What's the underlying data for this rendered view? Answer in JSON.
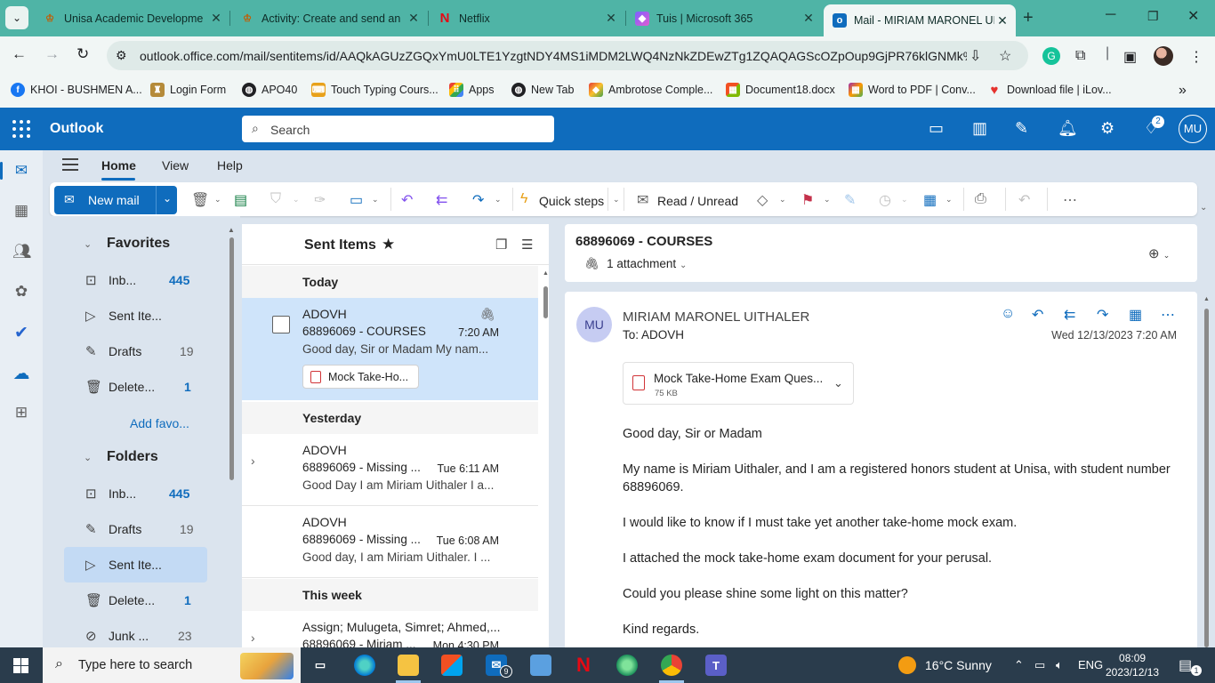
{
  "browser": {
    "tabs": [
      {
        "title": "Unisa Academic Developme",
        "favicon": "unisa-icon"
      },
      {
        "title": "Activity: Create and send an",
        "favicon": "unisa-icon"
      },
      {
        "title": "Netflix",
        "favicon": "netflix-icon"
      },
      {
        "title": "Tuis | Microsoft 365",
        "favicon": "m365-icon"
      },
      {
        "title": "Mail - MIRIAM MARONEL UI",
        "favicon": "outlook-icon",
        "active": true
      }
    ],
    "url": "outlook.office.com/mail/sentitems/id/AAQkAGUzZGQxYmU0LTE1YzgtNDY4MS1iMDM2LWQ4NzNkZDEwZTg1ZQAQAGScOZpOup9GjPR76klGNMk%3D",
    "bookmarks": [
      {
        "label": "KHOI - BUSHMEN A...",
        "icon": "facebook-icon",
        "color": "#1877f2"
      },
      {
        "label": "Login Form",
        "icon": "trophy-icon",
        "color": "#b58b3a"
      },
      {
        "label": "APO40",
        "icon": "globe-icon",
        "color": "#202124"
      },
      {
        "label": "Touch Typing Cours...",
        "icon": "typing-icon",
        "color": "#e8a11a"
      },
      {
        "label": "Apps",
        "icon": "apps-grid-icon",
        "color": "#4285f4"
      },
      {
        "label": "New Tab",
        "icon": "globe-icon",
        "color": "#202124"
      },
      {
        "label": "Ambrotose Comple...",
        "icon": "ambrotose-icon",
        "color": "#e53935"
      },
      {
        "label": "Document18.docx",
        "icon": "office-icon",
        "color": "#eb3c00"
      },
      {
        "label": "Word to PDF | Conv...",
        "icon": "pdf-tool-icon",
        "color": "#9c27b0"
      },
      {
        "label": "Download file | iLov...",
        "icon": "heart-icon",
        "color": "#e5322d"
      }
    ]
  },
  "outlook": {
    "app_name": "Outlook",
    "search_placeholder": "Search",
    "notification_badge": "2",
    "user_initials": "MU",
    "ribbon_tabs": [
      "Home",
      "View",
      "Help"
    ],
    "ribbon": {
      "new_mail": "New mail",
      "quick_steps": "Quick steps",
      "read_unread": "Read / Unread"
    },
    "folders": {
      "favorites_header": "Favorites",
      "favorites": [
        {
          "label": "Inb...",
          "count": "445",
          "icon": "inbox-icon",
          "count_style": "blue"
        },
        {
          "label": "Sent Ite...",
          "count": "",
          "icon": "send-icon"
        },
        {
          "label": "Drafts",
          "count": "19",
          "icon": "pencil-icon",
          "count_style": "grey"
        },
        {
          "label": "Delete...",
          "count": "1",
          "icon": "trash-icon",
          "count_style": "blue"
        }
      ],
      "add_favorite": "Add favo...",
      "folders_header": "Folders",
      "folders": [
        {
          "label": "Inb...",
          "count": "445",
          "icon": "inbox-icon",
          "count_style": "blue"
        },
        {
          "label": "Drafts",
          "count": "19",
          "icon": "pencil-icon",
          "count_style": "grey"
        },
        {
          "label": "Sent Ite...",
          "count": "",
          "icon": "send-icon",
          "active": true
        },
        {
          "label": "Delete...",
          "count": "1",
          "icon": "trash-icon",
          "count_style": "blue"
        },
        {
          "label": "Junk ...",
          "count": "23",
          "icon": "junk-icon",
          "count_style": "grey"
        }
      ]
    },
    "message_list": {
      "title": "Sent Items",
      "groups": {
        "today": "Today",
        "yesterday": "Yesterday",
        "this_week": "This week"
      },
      "messages": [
        {
          "sender": "ADOVH",
          "subject": "68896069 - COURSES",
          "time": "7:20 AM",
          "preview": "Good day, Sir or Madam My nam...",
          "attachment": "Mock Take-Ho..."
        },
        {
          "sender": "ADOVH",
          "subject": "68896069 - Missing ...",
          "time": "Tue 6:11 AM",
          "preview": "Good Day I am Miriam Uithaler I a..."
        },
        {
          "sender": "ADOVH",
          "subject": "68896069 - Missing ...",
          "time": "Tue 6:08 AM",
          "preview": "Good day, I am Miriam Uithaler. I ..."
        },
        {
          "sender": "Assign; Mulugeta, Simret; Ahmed,...",
          "subject": "68896069 - Miriam ...",
          "time": "Mon 4:30 PM",
          "preview": ""
        }
      ]
    },
    "reading": {
      "subject": "68896069 - COURSES",
      "attachment_summary": "1 attachment",
      "from_initials": "MU",
      "from": "MIRIAM MARONEL UITHALER",
      "to": "To:  ADOVH",
      "date": "Wed 12/13/2023 7:20 AM",
      "attachment_name": "Mock Take-Home Exam Ques...",
      "attachment_size": "75 KB",
      "body": [
        "Good day, Sir or Madam",
        "My name is Miriam Uithaler, and I am a registered honors student at Unisa, with student number 68896069.",
        "I would like to know if I must take yet another take-home mock exam.",
        "I attached the mock take-home exam document for your perusal.",
        "Could you please shine some light on this matter?",
        "Kind regards."
      ]
    }
  },
  "taskbar": {
    "search_placeholder": "Type here to search",
    "weather": "16°C  Sunny",
    "language": "ENG",
    "time": "08:09",
    "date": "2023/12/13",
    "mail_badge": "9",
    "notification_count": "1"
  },
  "colors": {
    "outlook_blue": "#0f6cbd",
    "tab_strip": "#4fb4a6",
    "selected_row": "#cfe4fa"
  }
}
